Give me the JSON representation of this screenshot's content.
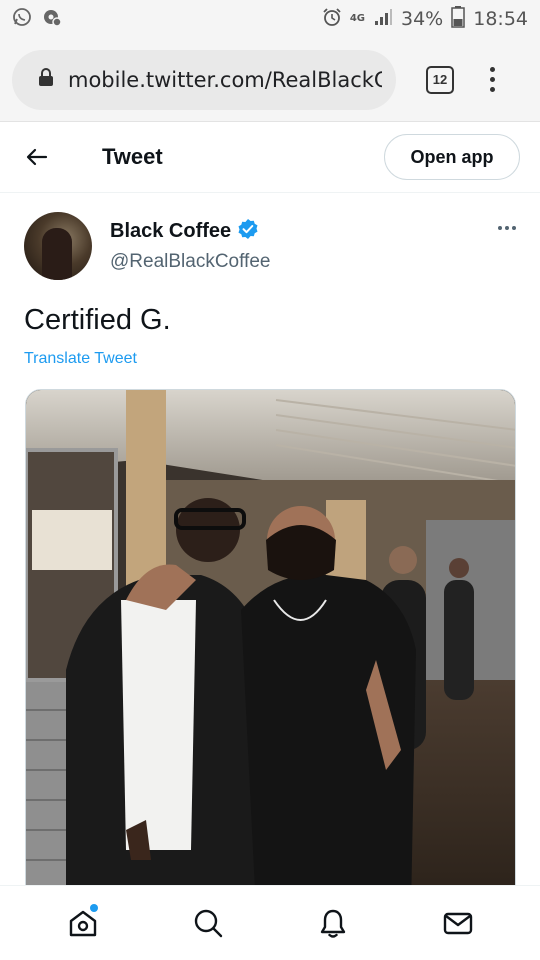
{
  "status_bar": {
    "network": "4G",
    "battery": "34%",
    "time": "18:54",
    "icons": [
      "whatsapp-icon",
      "settings-notification-icon",
      "alarm-icon",
      "signal-icon",
      "battery-icon"
    ]
  },
  "browser": {
    "url": "mobile.twitter.com/RealBlackC",
    "tab_count": "12"
  },
  "header": {
    "title": "Tweet",
    "open_app_label": "Open app"
  },
  "tweet": {
    "author_name": "Black Coffee",
    "handle": "@RealBlackCoffee",
    "verified": true,
    "text": "Certified G.",
    "translate_label": "Translate Tweet",
    "image_alt": "Two men posing together in a restaurant"
  },
  "nav": {
    "items": [
      "home-icon",
      "search-icon",
      "notifications-icon",
      "messages-icon"
    ]
  },
  "colors": {
    "accent": "#1d9bf0",
    "text": "#0f1419",
    "secondary": "#536471"
  }
}
